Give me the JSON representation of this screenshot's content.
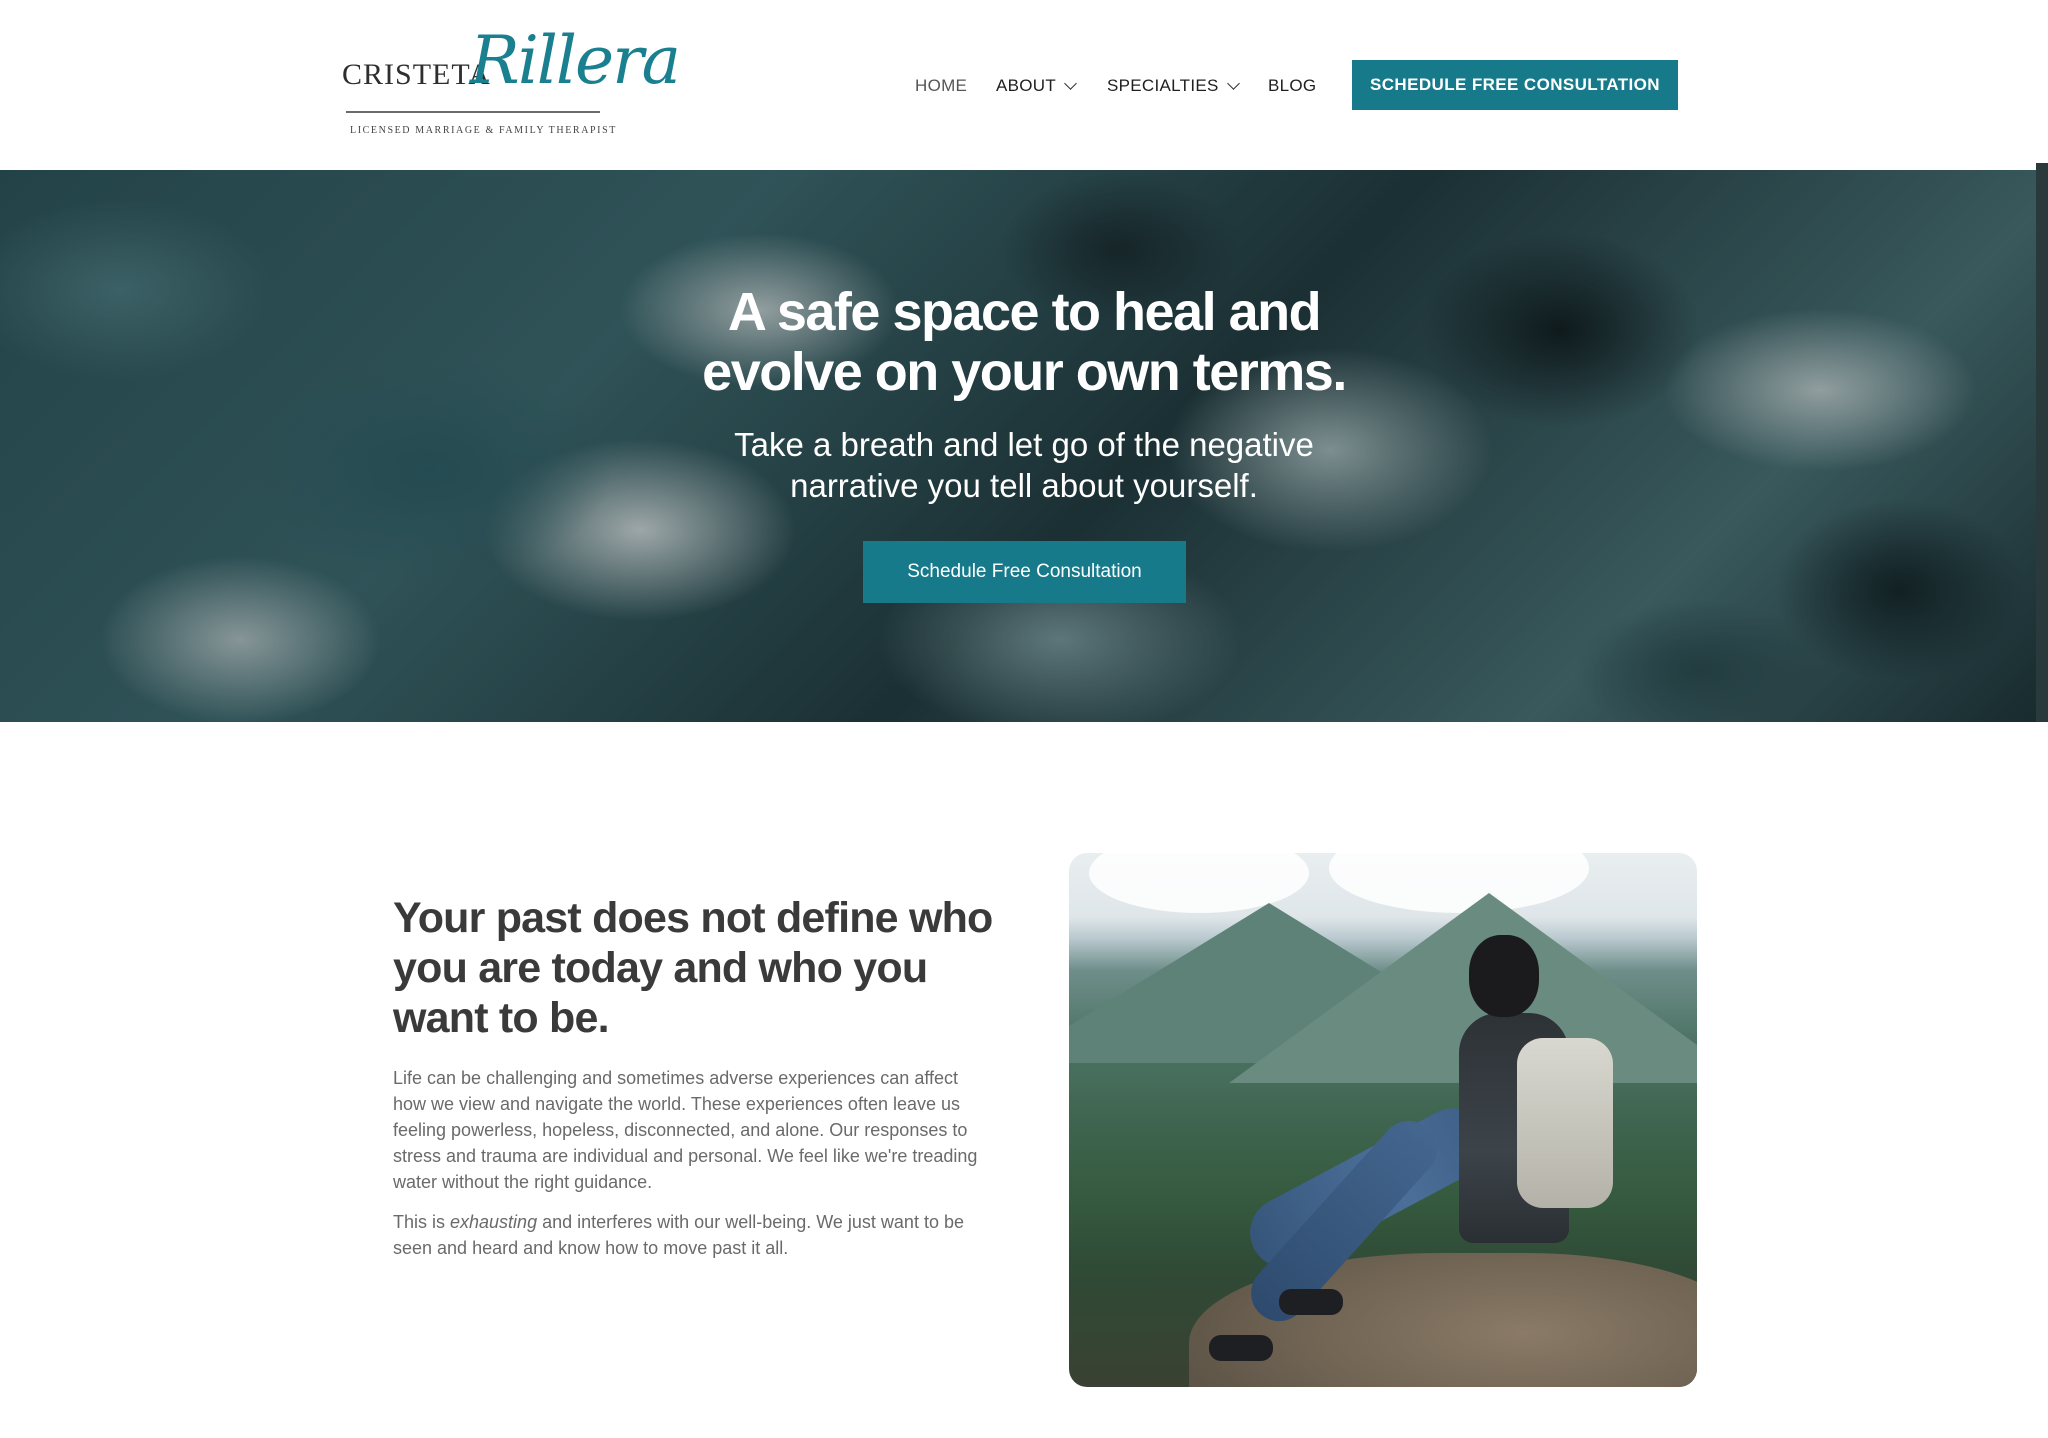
{
  "logo": {
    "first_name": "CRISTETA",
    "last_name": "Rillera",
    "tagline": "LICENSED MARRIAGE & FAMILY THERAPIST"
  },
  "nav": {
    "items": [
      {
        "label": "HOME",
        "has_dropdown": false,
        "active": true
      },
      {
        "label": "ABOUT",
        "has_dropdown": true,
        "active": false
      },
      {
        "label": "SPECIALTIES",
        "has_dropdown": true,
        "active": false
      },
      {
        "label": "BLOG",
        "has_dropdown": false,
        "active": false
      }
    ],
    "cta_label": "SCHEDULE FREE CONSULTATION"
  },
  "hero": {
    "title_line1": "A safe space to heal and",
    "title_line2": "evolve on your own terms.",
    "subtitle_line1": "Take a breath and let go of the negative",
    "subtitle_line2": "narrative you tell about yourself.",
    "cta_label": "Schedule Free Consultation"
  },
  "intro": {
    "heading": "Your past does not define who you are today and who you want to be.",
    "paragraph1": "Life can be challenging and sometimes adverse experiences can affect how we view and navigate the world. These experiences often leave us feeling powerless, hopeless, disconnected, and alone. Our responses to stress and trauma are individual and personal. We feel like we're treading water without the right guidance.",
    "paragraph2_prefix": "This is ",
    "paragraph2_emphasis": "exhausting",
    "paragraph2_suffix": " and interferes with our well-being. We just want to be seen and heard and know how to move past it all."
  },
  "colors": {
    "accent": "#177a8b",
    "heading_text": "#3a3a3a",
    "body_text": "#6a6a6a"
  },
  "icons": {
    "dropdown": "chevron-down-icon"
  }
}
